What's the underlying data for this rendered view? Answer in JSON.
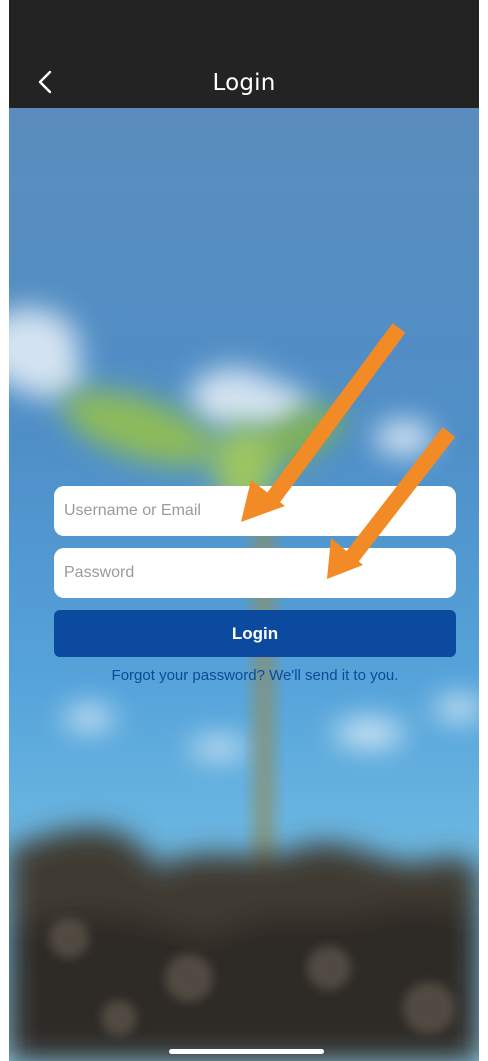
{
  "nav": {
    "title": "Login",
    "back_icon": "chevron-left-icon"
  },
  "form": {
    "username": {
      "placeholder": "Username or Email",
      "value": ""
    },
    "password": {
      "placeholder": "Password",
      "value": ""
    },
    "login_label": "Login",
    "forgot_label": "Forgot your password? We'll send it to you."
  },
  "annotations": {
    "arrow_color": "#f28a25",
    "arrow_count": 2
  },
  "colors": {
    "nav_bg": "#232323",
    "button_bg": "#0b4a9e",
    "link": "#0c4a9a"
  }
}
